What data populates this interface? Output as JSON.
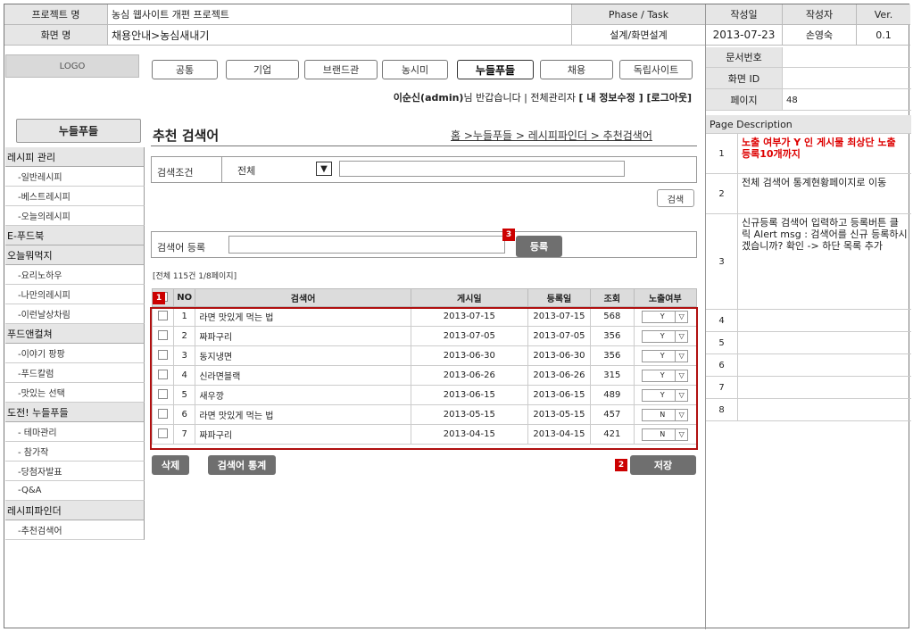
{
  "header": {
    "project_label": "프로젝트 명",
    "project_value": "농심 웹사이트 개편 프로젝트",
    "phase_label": "Phase / Task",
    "author_date_label": "작성일",
    "author_label": "작성자",
    "ver_label": "Ver.",
    "screen_label": "화면 명",
    "screen_value": "채용안내>농심새내기",
    "phase_value": "설계/화면설계",
    "date_value": "2013-07-23",
    "author_value": "손영숙",
    "ver_value": "0.1",
    "docno_label": "문서번호",
    "screenid_label": "화면 ID",
    "page_label": "페이지",
    "page_value": "48"
  },
  "logo": "LOGO",
  "nav": [
    "공통",
    "기업",
    "브랜드관",
    "농시미",
    "누들푸들",
    "채용",
    "독립사이트"
  ],
  "userline": {
    "user": "이순신(admin)",
    "greeting": "님 반갑습니다 | 전체관리자",
    "links": "[ 내 정보수정 ] [로그아웃]"
  },
  "sidebar": {
    "title": "누들푸들",
    "items": [
      {
        "label": "레시피 관리",
        "cat": true
      },
      {
        "label": "-일반레시피",
        "cat": false
      },
      {
        "label": "-베스트레시피",
        "cat": false
      },
      {
        "label": "-오늘의레시피",
        "cat": false
      },
      {
        "label": "E-푸드북",
        "cat": true
      },
      {
        "label": "오늘뭐먹지",
        "cat": true
      },
      {
        "label": "-요리노하우",
        "cat": false
      },
      {
        "label": "-나만의레시피",
        "cat": false
      },
      {
        "label": "-이런날상차림",
        "cat": false
      },
      {
        "label": "푸드앤컬쳐",
        "cat": true
      },
      {
        "label": "-이야기 팡팡",
        "cat": false
      },
      {
        "label": "-푸드칼럼",
        "cat": false
      },
      {
        "label": "-맛있는 선택",
        "cat": false
      },
      {
        "label": "도전! 누들푸들",
        "cat": true
      },
      {
        "label": "- 테마관리",
        "cat": false
      },
      {
        "label": "- 참가작",
        "cat": false
      },
      {
        "label": "-당첨자발표",
        "cat": false
      },
      {
        "label": "-Q&A",
        "cat": false
      },
      {
        "label": "레시피파인더",
        "cat": true
      },
      {
        "label": "-추천검색어",
        "cat": false
      }
    ]
  },
  "main": {
    "title": "추천 검색어",
    "breadcrumb": "홈 >누들푸들 > 레시피파인더 > 추천검색어",
    "search": {
      "label": "검색조건",
      "select": "전체",
      "button": "검색"
    },
    "register": {
      "label": "검색어 등록",
      "button": "등록",
      "badge": "3"
    },
    "count": "[전체 115건  1/8페이지]",
    "columns": [
      "NO",
      "검색어",
      "게시일",
      "등록일",
      "조회",
      "노출여부"
    ],
    "rows": [
      [
        "1",
        "라면 맛있게 먹는 법",
        "2013-07-15",
        "2013-07-15",
        "568",
        "Y"
      ],
      [
        "2",
        "짜파구리",
        "2013-07-05",
        "2013-07-05",
        "356",
        "Y"
      ],
      [
        "3",
        "동지냉면",
        "2013-06-30",
        "2013-06-30",
        "356",
        "Y"
      ],
      [
        "4",
        "신라면블랙",
        "2013-06-26",
        "2013-06-26",
        "315",
        "Y"
      ],
      [
        "5",
        "새우깡",
        "2013-06-15",
        "2013-06-15",
        "489",
        "Y"
      ],
      [
        "6",
        "라면 맛있게 먹는 법",
        "2013-05-15",
        "2013-05-15",
        "457",
        "N"
      ],
      [
        "7",
        "짜파구리",
        "2013-04-15",
        "2013-04-15",
        "421",
        "N"
      ]
    ],
    "badge1": "1",
    "badge2": "2",
    "delete_btn": "삭제",
    "stats_btn": "검색어 통계",
    "save_btn": "저장"
  },
  "desc": {
    "title": "Page Description",
    "items": [
      {
        "n": "1",
        "t": "노출 여부가 Y 인 게시물 최상단 노출 등록10개까지"
      },
      {
        "n": "2",
        "t": "전체 검색어 통계현황페이지로 이동"
      },
      {
        "n": "3",
        "t": "신규등록 검색어 입력하고 등록버튼 클릭 Alert msg : 검색어를 신규 등록하시겠습니까? 확인 -> 하단 목록 추가"
      },
      {
        "n": "4",
        "t": ""
      },
      {
        "n": "5",
        "t": ""
      },
      {
        "n": "6",
        "t": ""
      },
      {
        "n": "7",
        "t": ""
      },
      {
        "n": "8",
        "t": ""
      }
    ]
  }
}
